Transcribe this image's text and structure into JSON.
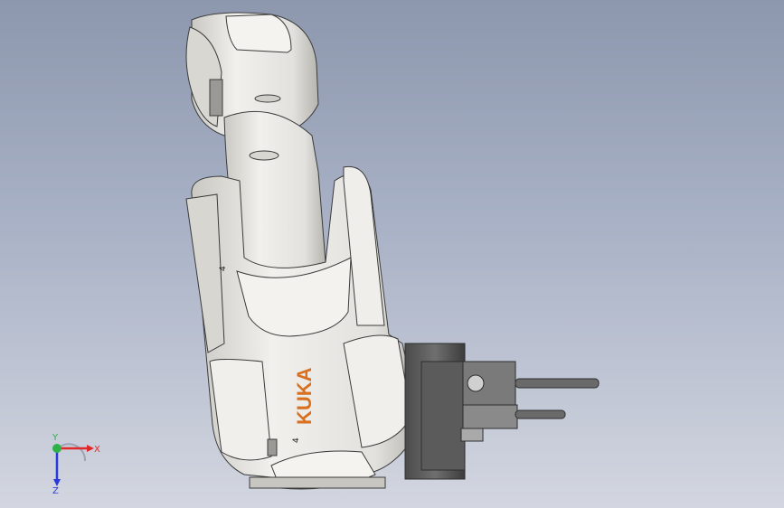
{
  "viewport": {
    "background_top": "#8d97ad",
    "background_bottom": "#d3d6e0"
  },
  "model": {
    "brand_text": "KUKA",
    "brand_color": "#d9701f",
    "body_color": "#e6e5e1",
    "shadow_color": "#b7b6b1",
    "outline_color": "#3b3b3b",
    "base_color": "#5d5d5d",
    "axis_marker_upper": "4",
    "axis_marker_lower": "4"
  },
  "triad": {
    "x_label": "X",
    "y_label": "Y",
    "z_label": "Z",
    "x_color": "#e02a2a",
    "y_color": "#2fb14a",
    "z_color": "#2a3ad8"
  }
}
